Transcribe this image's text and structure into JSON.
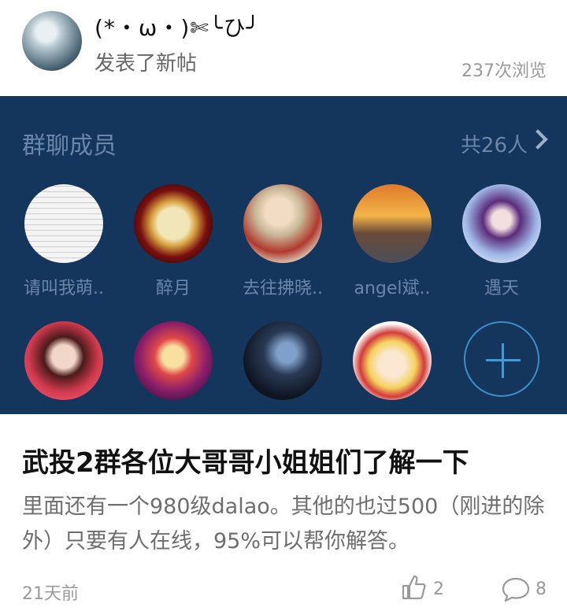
{
  "header": {
    "username": "(*・ω・)✄╰ひ╯",
    "action": "发表了新帖",
    "views": "237次浏览"
  },
  "group": {
    "title": "群聊成员",
    "count": "共26人",
    "members": [
      {
        "name": "请叫我萌.."
      },
      {
        "name": "醉月"
      },
      {
        "name": "去往拂晓.."
      },
      {
        "name": "angel斌.."
      },
      {
        "name": "遇天"
      },
      {
        "name": ""
      },
      {
        "name": ""
      },
      {
        "name": ""
      },
      {
        "name": ""
      }
    ]
  },
  "post": {
    "title": "武投2群各位大哥哥小姐姐们了解一下",
    "body": "里面还有一个980级dalao。其他的也过500（刚进的除外）只要有人在线，95%可以帮你解答。",
    "time": "21天前",
    "likes": "2",
    "comments": "8"
  },
  "colors": {
    "group_bg": "#15365c",
    "group_text": "#6a86a8",
    "accent": "#3f9ad8"
  }
}
